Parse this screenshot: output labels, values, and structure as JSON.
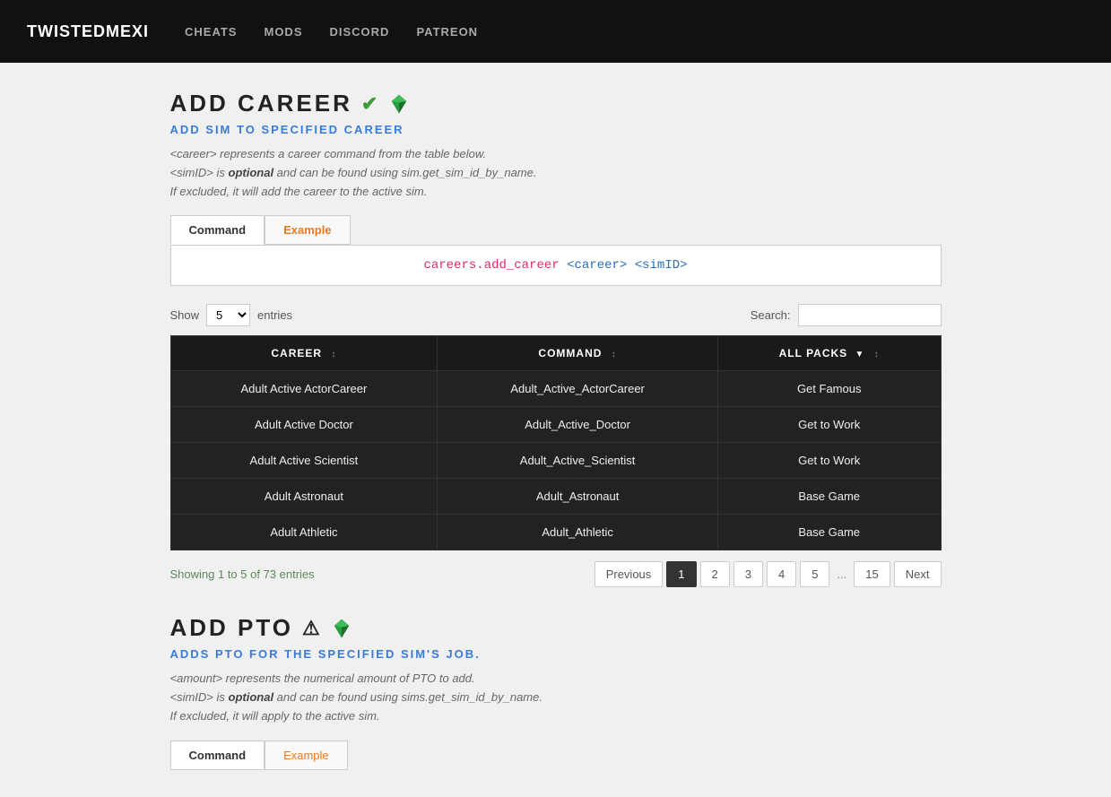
{
  "navbar": {
    "brand": "TWISTEDMEXI",
    "links": [
      "CHEATS",
      "MODS",
      "DISCORD",
      "PATREON"
    ]
  },
  "addCareer": {
    "title": "ADD CAREER",
    "subtitle": "ADD SIM TO SPECIFIED CAREER",
    "description_lines": [
      "<career> represents a career command from the table below.",
      "<simID> is optional and can be found using sim.get_sim_id_by_name.",
      "If excluded, it will add the career to the active sim."
    ],
    "tabs": [
      "Command",
      "Example"
    ],
    "active_tab": "Command",
    "command_text": "careers.add_career <career> <simID>",
    "show_label": "Show",
    "entries_label": "entries",
    "show_value": "5",
    "search_label": "Search:",
    "search_placeholder": "",
    "table": {
      "headers": [
        "CAREER",
        "COMMAND",
        "ALL PACKS"
      ],
      "rows": [
        [
          "Adult Active ActorCareer",
          "Adult_Active_ActorCareer",
          "Get Famous"
        ],
        [
          "Adult Active Doctor",
          "Adult_Active_Doctor",
          "Get to Work"
        ],
        [
          "Adult Active Scientist",
          "Adult_Active_Scientist",
          "Get to Work"
        ],
        [
          "Adult Astronaut",
          "Adult_Astronaut",
          "Base Game"
        ],
        [
          "Adult Athletic",
          "Adult_Athletic",
          "Base Game"
        ]
      ]
    },
    "pagination": {
      "info": "Showing 1 to 5 of 73 entries",
      "pages": [
        "Previous",
        "1",
        "2",
        "3",
        "4",
        "5",
        "...",
        "15",
        "Next"
      ],
      "active_page": "1"
    }
  },
  "addPto": {
    "title": "ADD PTO",
    "subtitle": "ADDS PTO FOR THE SPECIFIED SIM'S JOB.",
    "description_lines": [
      "<amount> represents the numerical amount of PTO to add.",
      "<simID> is optional and can be found using sims.get_sim_id_by_name.",
      "If excluded, it will apply to the active sim."
    ],
    "tabs": [
      "Command",
      "Example"
    ],
    "active_tab": "Command"
  }
}
